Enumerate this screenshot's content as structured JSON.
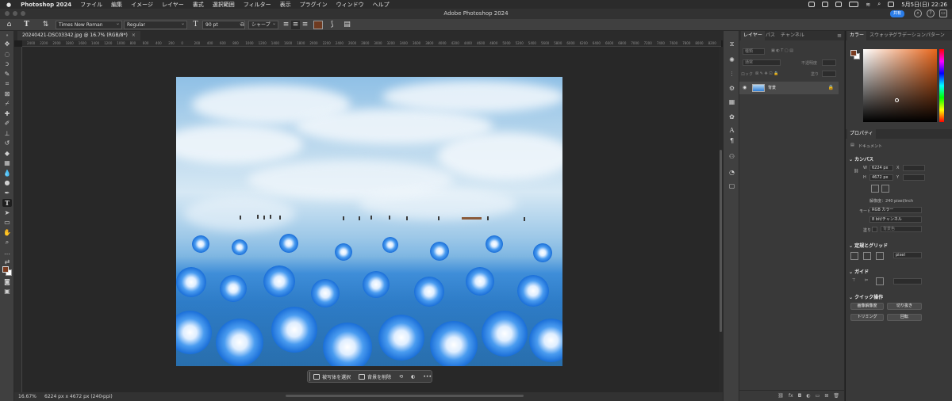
{
  "menubar": {
    "app": "Photoshop 2024",
    "items": [
      "ファイル",
      "編集",
      "イメージ",
      "レイヤー",
      "書式",
      "選択範囲",
      "フィルター",
      "表示",
      "プラグイン",
      "ウィンドウ",
      "ヘルプ"
    ],
    "clock": "5月5日(日)  22:26"
  },
  "titlebar": {
    "title": "Adobe Photoshop 2024",
    "share": "共有"
  },
  "options": {
    "font_family": "Times New Roman",
    "font_style": "Regular",
    "font_size": "90 pt",
    "antialias": "シャープ",
    "text_color": "#6e3a20"
  },
  "document": {
    "tab_title": "20240421-DSC03342.jpg @ 16.7% (RGB/8*)"
  },
  "ruler": [
    "2400",
    "2200",
    "2000",
    "1800",
    "1600",
    "1400",
    "1200",
    "1000",
    "800",
    "600",
    "400",
    "200",
    "0",
    "200",
    "400",
    "600",
    "800",
    "1000",
    "1200",
    "1400",
    "1600",
    "1800",
    "2000",
    "2200",
    "2400",
    "2600",
    "2800",
    "3000",
    "3200",
    "3400",
    "3600",
    "3800",
    "4000",
    "4200",
    "4400",
    "4600",
    "4800",
    "5000",
    "5200",
    "5400",
    "5600",
    "5800",
    "6000",
    "6200",
    "6400",
    "6600",
    "6800",
    "7000",
    "7200",
    "7400",
    "7600",
    "7800",
    "8000",
    "8200",
    "8400"
  ],
  "context_bar": {
    "select_subject": "被写体を選択",
    "remove_bg": "背景を削除",
    "more": "•••"
  },
  "status": {
    "zoom": "16.67%",
    "info": "6224 px x 4672 px (240 ppi)"
  },
  "layers_panel": {
    "tabs": [
      "レイヤー",
      "パス",
      "チャンネル"
    ],
    "search": "種類",
    "blend_placeholder": "通常",
    "opacity_label": "不透明度",
    "lock_label": "ロック",
    "fill_label": "塗り",
    "layer_name": "背景"
  },
  "color_panel": {
    "tabs": [
      "カラー",
      "スウォッチ",
      "グラデーション",
      "パターン"
    ],
    "fg": "#7a3b1f",
    "bg": "#ffffff"
  },
  "properties": {
    "tab": "プロパティ",
    "doc_label": "ドキュメント",
    "canvas_section": "カンバス",
    "w_label": "W",
    "w_value": "6224 px",
    "h_label": "H",
    "h_value": "4672 px",
    "x_label": "X",
    "y_label": "Y",
    "resolution": "解像度：240 pixel/inch",
    "mode_label": "モード",
    "mode_value": "RGB カラー",
    "depth_value": "8 bit/チャンネル",
    "fill_label": "塗り",
    "fill_value": "背景色",
    "rulers_section": "定規とグリッド",
    "unit_value": "pixel",
    "guides_section": "ガイド",
    "quick_section": "クイック操作",
    "btn_resize": "画像解像度",
    "btn_crop": "切り抜き",
    "btn_trim": "トリミング",
    "btn_rotate": "回転"
  }
}
